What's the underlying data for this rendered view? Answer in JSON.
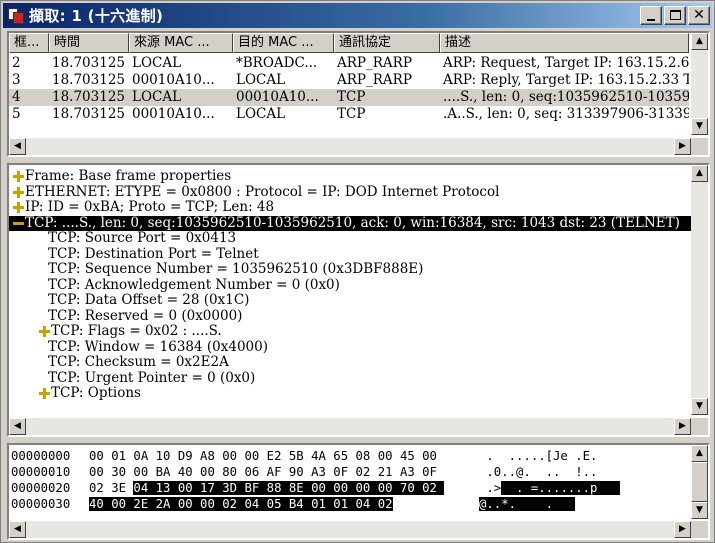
{
  "window": {
    "title": "擷取: 1 (十六進制)"
  },
  "packet_list": {
    "columns": [
      "框...",
      "時間",
      "來源 MAC ...",
      "目的 MAC ...",
      "通訊協定",
      "描述"
    ],
    "rows": [
      [
        "2",
        "18.703125",
        "LOCAL",
        "*BROADC...",
        "ARP_RARP",
        "ARP: Request, Target IP: 163.15.2.62"
      ],
      [
        "3",
        "18.703125",
        "00010A10...",
        "LOCAL",
        "ARP_RARP",
        "ARP: Reply, Target IP: 163.15.2.33 Ta"
      ],
      [
        "4",
        "18.703125",
        "LOCAL",
        "00010A10...",
        "TCP",
        "....S., len:    0, seq:1035962510-103596"
      ],
      [
        "5",
        "18.703125",
        "00010A10...",
        "LOCAL",
        "TCP",
        ".A..S., len:    0, seq: 313397906-31339"
      ]
    ],
    "selected_row": 2
  },
  "detail_tree": [
    {
      "expander": "plus",
      "indent": 0,
      "text": "Frame: Base frame properties"
    },
    {
      "expander": "plus",
      "indent": 0,
      "text": "ETHERNET: ETYPE = 0x0800 : Protocol = IP:  DOD Internet Protocol"
    },
    {
      "expander": "plus",
      "indent": 0,
      "text": "IP: ID = 0xBA; Proto = TCP; Len: 48"
    },
    {
      "expander": "minus",
      "indent": 0,
      "text": "TCP: ....S., len:    0, seq:1035962510-1035962510, ack:          0, win:16384, src: 1043  dst:   23  (TELNET)",
      "selected": true
    },
    {
      "expander": "none",
      "indent": 1,
      "text": "TCP: Source Port = 0x0413"
    },
    {
      "expander": "none",
      "indent": 1,
      "text": "TCP: Destination Port = Telnet"
    },
    {
      "expander": "none",
      "indent": 1,
      "text": "TCP: Sequence Number = 1035962510 (0x3DBF888E)"
    },
    {
      "expander": "none",
      "indent": 1,
      "text": "TCP: Acknowledgement Number = 0 (0x0)"
    },
    {
      "expander": "none",
      "indent": 1,
      "text": "TCP: Data Offset = 28 (0x1C)"
    },
    {
      "expander": "none",
      "indent": 1,
      "text": "TCP: Reserved = 0 (0x0000)"
    },
    {
      "expander": "plus",
      "indent": 1,
      "text": "TCP: Flags = 0x02 : ....S."
    },
    {
      "expander": "none",
      "indent": 1,
      "text": "TCP: Window = 16384 (0x4000)"
    },
    {
      "expander": "none",
      "indent": 1,
      "text": "TCP: Checksum = 0x2E2A"
    },
    {
      "expander": "none",
      "indent": 1,
      "text": "TCP: Urgent Pointer = 0 (0x0)"
    },
    {
      "expander": "plus",
      "indent": 1,
      "text": "TCP: Options"
    }
  ],
  "hex_view": [
    {
      "offset": "00000000",
      "bytes_plain": "00 01 0A 10 D9 A8 00 00 E2 5B 4A 65 08 00 45 00",
      "bytes_hl": "",
      "ascii_plain": " .  .....[Je .E.",
      "ascii_hl": ""
    },
    {
      "offset": "00000010",
      "bytes_plain": "00 30 00 BA 40 00 80 06 AF 90 A3 0F 02 21 A3 0F",
      "bytes_hl": "",
      "ascii_plain": " .0..@.  ..  !..",
      "ascii_hl": ""
    },
    {
      "offset": "00000020",
      "bytes_plain": "02 3E ",
      "bytes_hl": "04 13 00 17 3D BF 88 8E 00 00 00 00 70 02 ",
      "ascii_plain": " .>",
      "ascii_hl": "  . =.......p   "
    },
    {
      "offset": "00000030",
      "bytes_plain": "",
      "bytes_hl": "40 00 2E 2A 00 00 02 04 05 B4 01 01 04 02",
      "ascii_plain": "",
      "ascii_hl": "@..*.    .   "
    }
  ],
  "icons": {
    "app": "capture-app-icon",
    "minimize": "minimize-icon",
    "maximize": "maximize-icon",
    "close": "close-icon",
    "scroll_up": "arrow-up-icon",
    "scroll_down": "arrow-down-icon",
    "scroll_left": "arrow-left-icon",
    "scroll_right": "arrow-right-icon"
  },
  "colors": {
    "title_start": "#0a246a",
    "title_end": "#a6caf0",
    "expander": "#c8a000",
    "highlight": "#000000"
  }
}
